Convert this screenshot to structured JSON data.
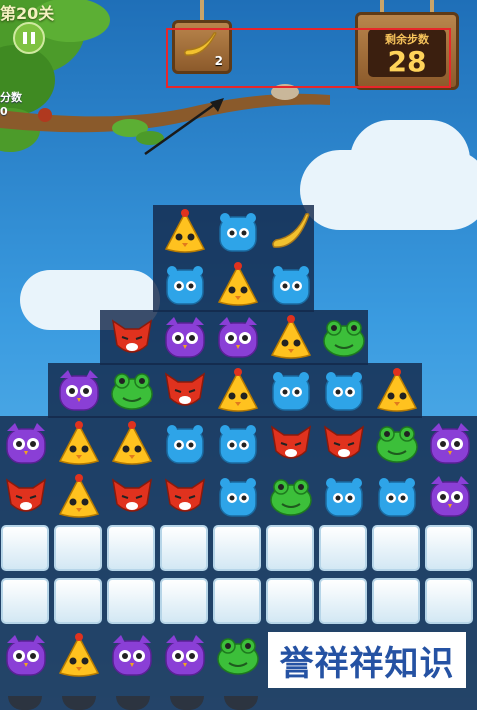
{
  "hud": {
    "level_title": "第20关",
    "score_label": "分数",
    "score_value": "0",
    "goal_count": "2",
    "goal_item": "banana-icon",
    "moves_label": "剩余步数",
    "moves_value": "28"
  },
  "board": {
    "rows": [
      [
        null,
        null,
        null,
        "chick",
        "bear",
        "banana",
        null,
        null,
        null
      ],
      [
        null,
        null,
        null,
        "bear",
        "chick",
        "bear",
        null,
        null,
        null
      ],
      [
        null,
        null,
        "fox",
        "owl",
        "owl",
        "chick",
        "frog",
        null,
        null
      ],
      [
        null,
        "owl",
        "frog",
        "fox",
        "chick",
        "bear",
        "bear",
        "chick",
        null
      ],
      [
        "owl",
        "chick",
        "chick",
        "bear",
        "bear",
        "fox",
        "fox",
        "frog",
        "owl"
      ],
      [
        "fox",
        "chick",
        "fox",
        "fox",
        "bear",
        "frog",
        "bear",
        "bear",
        "owl"
      ],
      [
        "ice",
        "ice",
        "ice",
        "ice",
        "ice",
        "ice",
        "ice",
        "ice",
        "ice"
      ],
      [
        "ice",
        "ice",
        "ice",
        "ice",
        "ice",
        "ice",
        "ice",
        "ice",
        "ice"
      ],
      [
        "owl",
        "chick",
        "owl",
        "owl",
        "frog",
        null,
        null,
        null,
        null
      ]
    ]
  },
  "colors": {
    "chick": "#ffc21f",
    "bear": "#2ea4e8",
    "owl": "#8a3fd6",
    "fox": "#e0321e",
    "frog": "#3cbf3a",
    "banana": "#f2c12e",
    "highlight": "#e8262a"
  },
  "watermark": {
    "text": "誉祥祥知识"
  }
}
